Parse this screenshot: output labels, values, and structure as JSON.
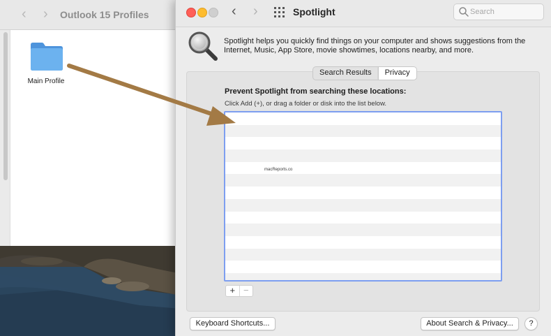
{
  "finder": {
    "title": "Outlook 15 Profiles",
    "folder_label": "Main Profile"
  },
  "prefs": {
    "title": "Spotlight",
    "search_placeholder": "Search",
    "description": "Spotlight helps you quickly find things on your computer and shows suggestions from the Internet, Music, App Store, movie showtimes, locations nearby, and more.",
    "tabs": [
      {
        "label": "Search Results",
        "active": false
      },
      {
        "label": "Privacy",
        "active": true
      }
    ],
    "privacy": {
      "heading": "Prevent Spotlight from searching these locations:",
      "hint": "Click Add (+), or drag a folder or disk into the list below.",
      "watermark": "macReports.co"
    },
    "add_label": "+",
    "remove_label": "−",
    "keyboard_shortcuts_label": "Keyboard Shortcuts...",
    "about_label": "About Search & Privacy...",
    "help_label": "?"
  },
  "colors": {
    "close": "#ff5f57",
    "minimize": "#febc2e",
    "list_border": "#7d9ef0",
    "annotation_arrow": "#a37a45",
    "folder_blue": "#62a8e8"
  }
}
